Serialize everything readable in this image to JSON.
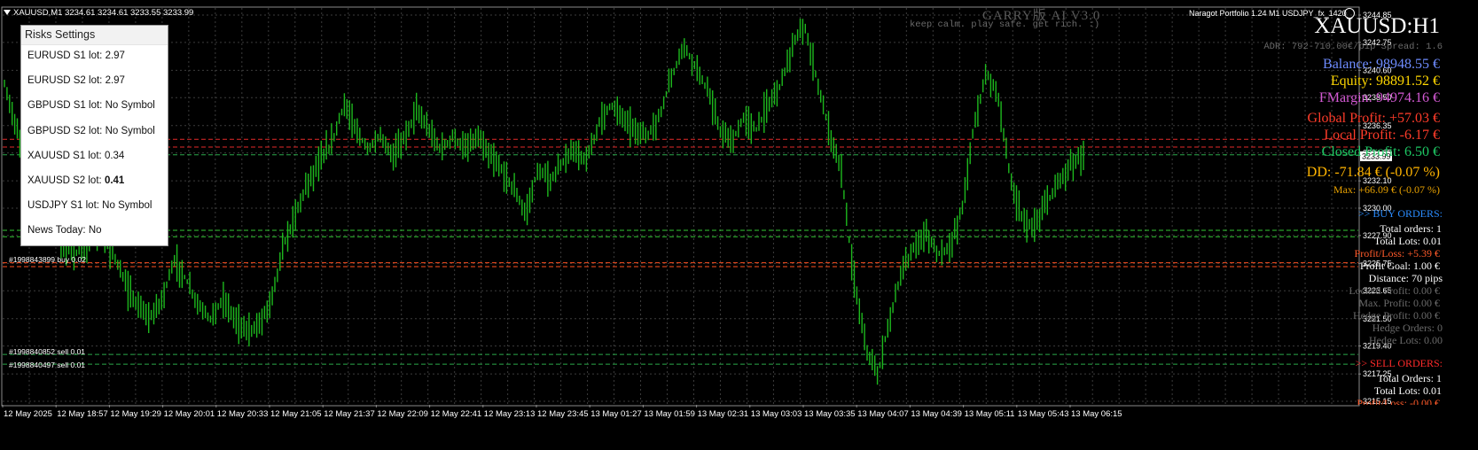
{
  "chart_header": {
    "symbol_info": "XAUUSD,M1  3234.61 3234.61 3233.55 3233.99",
    "top_center": "GARRY版 AI V3.0",
    "motto": "keep calm. play safe. get rich. :)",
    "top_right": "Naragot Portfolio 1.24 M1 USDJPY_fx_1420"
  },
  "risk_panel": {
    "title": "Risks Settings",
    "rows": [
      {
        "label": "EURUSD S1 lot:",
        "value": "2.97"
      },
      {
        "label": "EURUSD S2 lot:",
        "value": "2.97"
      },
      {
        "label": "GBPUSD S1 lot:",
        "value": "No Symbol"
      },
      {
        "label": "GBPUSD S2 lot:",
        "value": "No Symbol"
      },
      {
        "label": "XAUUSD S1 lot:",
        "value": "0.34"
      },
      {
        "label": "XAUUSD S2 lot:",
        "value": "0.41"
      },
      {
        "label": "USDJPY S1 lot:",
        "value": "No Symbol"
      },
      {
        "label": "News Today:",
        "value": "No"
      }
    ]
  },
  "stats": {
    "symbol": "XAUUSD:H1",
    "adr": "ADR: 792-710.00€/pip Spread: 1.6",
    "balance": "Balance: 98948.55 €",
    "equity": "Equity: 98891.52 €",
    "fmargin": "FMargin: 94974.16 €",
    "global_profit": "Global Profit: +57.03 €",
    "local_profit": "Local Profit: -6.17 €",
    "closed_profit": "Closed Profit: 6.50 €",
    "dd": "DD: -71.84 € (-0.07 %)",
    "max": "Max: +66.09 € (-0.07 %)"
  },
  "buy_orders": {
    "header": ">> BUY ORDERS:",
    "total_orders": "Total orders: 1",
    "total_lots": "Total Lots: 0.01",
    "profit_loss": "Profit/Loss: +5.39 €",
    "profit_goal": "Profit Goal: 1.00 €",
    "distance": "Distance: 70 pips",
    "locked_profit": "Locked Profit: 0.00 €",
    "max_profit": "Max. Profit: 0.00 €",
    "hedge_profit": "Hedge Profit: 0.00 €",
    "hedge_orders": "Hedge Orders: 0",
    "hedge_lots": "Hedge Lots: 0.00"
  },
  "sell_orders": {
    "header": ">> SELL ORDERS:",
    "total_orders": "Total Orders: 1",
    "total_lots": "Total Lots: 0.01",
    "profit_loss": "Profit/Loss: -0.00 €"
  },
  "order_labels": [
    {
      "text": "#1998840852 sell 0.01",
      "price": 3218.75
    },
    {
      "text": "#1998840497 sell 0.01",
      "price": 3218.0
    }
  ],
  "order_label_overlap": "#1998843899 buy 0.02",
  "price_axis": {
    "ticks": [
      "3244.85",
      "3242.75",
      "3240.60",
      "3238.50",
      "3236.35",
      "3234.25",
      "3232.10",
      "3230.00",
      "3227.90",
      "3225.75",
      "3223.65",
      "3221.50",
      "3219.40",
      "3217.25",
      "3215.15"
    ],
    "current_price": "3233.99"
  },
  "time_axis": {
    "labels": [
      "12 May 2025",
      "12 May 18:57",
      "12 May 19:29",
      "12 May 20:01",
      "12 May 20:33",
      "12 May 21:05",
      "12 May 21:37",
      "12 May 22:09",
      "12 May 22:41",
      "12 May 23:13",
      "12 May 23:45",
      "13 May 01:27",
      "13 May 01:59",
      "13 May 02:31",
      "13 May 03:03",
      "13 May 03:35",
      "13 May 04:07",
      "13 May 04:39",
      "13 May 05:11",
      "13 May 05:43",
      "13 May 06:15"
    ]
  },
  "chart_data": {
    "type": "line",
    "ylim": [
      3215.15,
      3244.85
    ],
    "series": [
      {
        "values": [
          3239.5,
          3236.0,
          3233.0,
          3230.0,
          3228.0,
          3227.0,
          3226.5,
          3227.5,
          3228.0,
          3226.5,
          3224.0,
          3222.5,
          3221.5,
          3223.0,
          3226.0,
          3224.5,
          3222.5,
          3221.5,
          3223.0,
          3221.5,
          3220.5,
          3221.0,
          3223.0,
          3227.0,
          3229.5,
          3232.0,
          3233.5,
          3235.0,
          3238.0,
          3236.0,
          3234.5,
          3235.5,
          3234.0,
          3235.5,
          3237.5,
          3236.0,
          3234.5,
          3235.5,
          3234.5,
          3235.5,
          3234.0,
          3233.0,
          3231.5,
          3229.5,
          3233.0,
          3232.0,
          3233.5,
          3234.5,
          3233.5,
          3236.5,
          3238.0,
          3237.0,
          3236.0,
          3235.5,
          3237.0,
          3240.0,
          3242.5,
          3241.0,
          3239.0,
          3236.0,
          3235.0,
          3237.0,
          3236.0,
          3238.0,
          3239.5,
          3242.5,
          3244.0,
          3240.0,
          3236.0,
          3233.0,
          3225.0,
          3219.5,
          3217.0,
          3221.5,
          3225.0,
          3227.0,
          3228.0,
          3226.5,
          3227.0,
          3230.0,
          3236.5,
          3240.5,
          3238.5,
          3232.0,
          3229.0,
          3228.5,
          3230.5,
          3232.0,
          3233.5,
          3234.0
        ]
      }
    ],
    "line_color": "#1db81d",
    "horizontal_lines": [
      {
        "price": 3235.3,
        "color": "#e52a2a"
      },
      {
        "price": 3234.7,
        "color": "#e52a2a"
      },
      {
        "price": 3234.1,
        "color": "#2aa84a"
      },
      {
        "price": 3228.3,
        "color": "#33c833"
      },
      {
        "price": 3227.8,
        "color": "#33c833"
      },
      {
        "price": 3225.8,
        "color": "#ff5020"
      },
      {
        "price": 3225.5,
        "color": "#ff5020"
      },
      {
        "price": 3218.75,
        "color": "#2aa84a"
      },
      {
        "price": 3218.0,
        "color": "#2aa84a"
      }
    ]
  },
  "colors": {
    "background": "#000000",
    "grid": "#3c3c3c",
    "balance": "#6e8cff",
    "equity": "#ffd700",
    "fmargin": "#d45ad4",
    "global_profit": "#ff3c2a",
    "local_profit": "#ff3c2a",
    "closed_profit": "#1ec864",
    "dd": "#ffb400",
    "max": "#e6a000",
    "buy_header": "#2a8cff",
    "sell_header": "#ff2a2a",
    "profit_loss_buy": "#ff5a2a",
    "dim": "#6a6a6a"
  }
}
